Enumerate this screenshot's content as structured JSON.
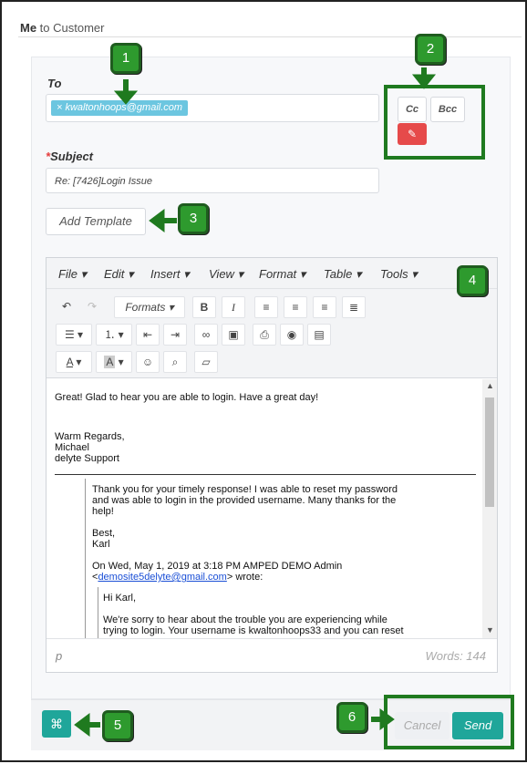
{
  "header": {
    "from": "Me",
    "rest": " to Customer"
  },
  "to": {
    "label": "To",
    "chip": "× kwaltonhoops@gmail.com"
  },
  "cc_label": "Cc",
  "bcc_label": "Bcc",
  "subject": {
    "star": "*",
    "label": "Subject",
    "value": "Re: [7426]Login Issue"
  },
  "template_button": "Add Template",
  "menu": [
    "File ▾",
    "Edit ▾",
    "Insert ▾",
    "View ▾",
    "Format ▾",
    "Table ▾",
    "Tools ▾"
  ],
  "toolbar": {
    "formats": "Formats ▾"
  },
  "body": {
    "line1": "Great! Glad to hear you are able to login.  Have a great day!",
    "sig1": "Warm Regards,",
    "sig2": "Michael",
    "sig3": "delyte Support",
    "q1": "Thank you for your timely response! I was able to reset my password",
    "q2": "and was able to login in the provided username. Many thanks for the",
    "q3": "help!",
    "q4": "Best,",
    "q5": "Karl",
    "q6": "On Wed, May 1, 2019 at 3:18 PM AMPED DEMO Admin",
    "q7a": "<",
    "q7link": "demosite5delyte@gmail.com",
    "q7b": "> wrote:",
    "q8": "Hi Karl,",
    "q9": "We're sorry to hear about the trouble you are experiencing while",
    "q10": "trying to login. Your username is kwaltonhoops33 and you can reset"
  },
  "status": {
    "path": "p",
    "words": "Words: 144"
  },
  "footer": {
    "cancel": "Cancel",
    "send": "Send"
  },
  "callouts": [
    "1",
    "2",
    "3",
    "4",
    "5",
    "6"
  ],
  "colors": {
    "accent": "#1fa69a",
    "danger": "#e64a4a",
    "chip": "#6cc6e0",
    "callout": "#2e9a2e"
  }
}
